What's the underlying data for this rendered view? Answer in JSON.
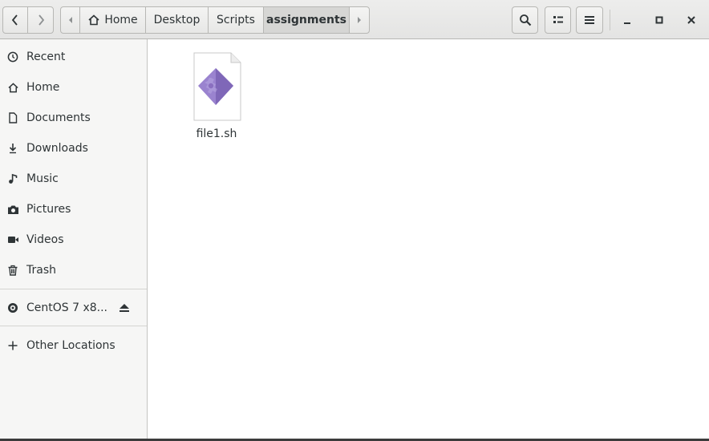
{
  "toolbar": {
    "back_icon": "chevron-left-icon",
    "forward_icon": "chevron-right-icon",
    "path_left_arrow_icon": "caret-left-icon",
    "path_right_arrow_icon": "caret-right-icon",
    "home_icon": "home-icon",
    "path": [
      {
        "label": "Home",
        "active": false
      },
      {
        "label": "Desktop",
        "active": false
      },
      {
        "label": "Scripts",
        "active": false
      },
      {
        "label": "assignments",
        "active": true
      }
    ],
    "search_icon": "search-icon",
    "view_icon": "list-view-icon",
    "menu_icon": "hamburger-menu-icon",
    "minimize_icon": "minimize-icon",
    "maximize_icon": "maximize-icon",
    "close_icon": "close-icon"
  },
  "sidebar": {
    "items": [
      {
        "label": "Recent",
        "icon": "clock-icon"
      },
      {
        "label": "Home",
        "icon": "home-icon"
      },
      {
        "label": "Documents",
        "icon": "document-icon"
      },
      {
        "label": "Downloads",
        "icon": "download-icon"
      },
      {
        "label": "Music",
        "icon": "music-icon"
      },
      {
        "label": "Pictures",
        "icon": "camera-icon"
      },
      {
        "label": "Videos",
        "icon": "video-icon"
      },
      {
        "label": "Trash",
        "icon": "trash-icon"
      }
    ],
    "devices": [
      {
        "label": "CentOS 7 x8...",
        "icon": "disc-icon",
        "eject_icon": "eject-icon"
      }
    ],
    "other": {
      "label": "Other Locations",
      "icon": "plus-icon"
    }
  },
  "main": {
    "files": [
      {
        "name": "file1.sh",
        "icon": "shell-script-icon"
      }
    ]
  },
  "colors": {
    "header_bg": "#e8e8e7",
    "sidebar_bg": "#f6f6f5",
    "active_path_bg": "#d6d6d4",
    "file_icon_accent": "#8a6fc0"
  }
}
